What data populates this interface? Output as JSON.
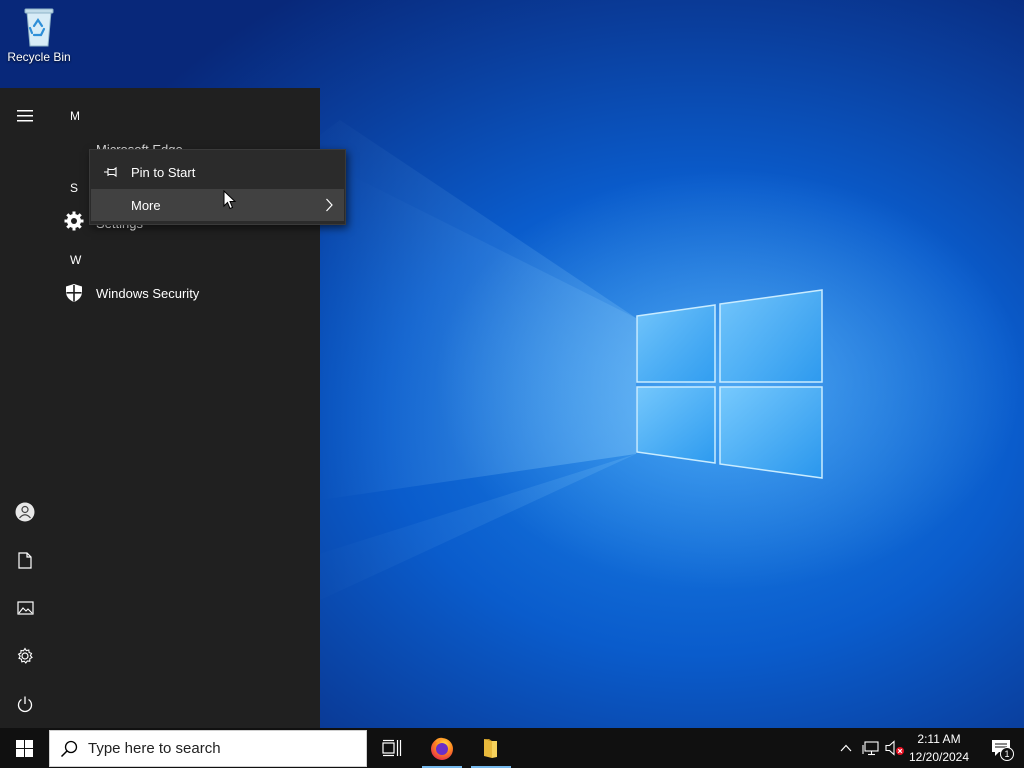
{
  "desktop": {
    "icons": [
      {
        "label": "Recycle Bin",
        "icon": "recycle-bin-icon"
      }
    ]
  },
  "start_menu": {
    "rail": [
      {
        "name": "expand",
        "icon": "hamburger-icon"
      },
      {
        "name": "account",
        "icon": "user-account-icon"
      },
      {
        "name": "documents",
        "icon": "document-icon"
      },
      {
        "name": "pictures",
        "icon": "pictures-icon"
      },
      {
        "name": "settings",
        "icon": "gear-icon"
      },
      {
        "name": "power",
        "icon": "power-icon"
      }
    ],
    "groups": [
      {
        "letter": "M",
        "apps": [
          {
            "label": "Microsoft Edge",
            "icon": "edge-icon"
          }
        ]
      },
      {
        "letter": "S",
        "apps": [
          {
            "label": "Settings",
            "icon": "gear-icon"
          }
        ]
      },
      {
        "letter": "W",
        "apps": [
          {
            "label": "Windows Security",
            "icon": "shield-icon"
          }
        ]
      }
    ]
  },
  "context_menu": {
    "items": [
      {
        "label": "Pin to Start",
        "icon": "pin-icon"
      },
      {
        "label": "More",
        "icon": "chevron-right-icon"
      }
    ]
  },
  "taskbar": {
    "search_placeholder": "Type here to search",
    "pinned": [
      {
        "name": "Task View",
        "icon": "task-view-icon"
      },
      {
        "name": "Firefox",
        "icon": "firefox-icon"
      },
      {
        "name": "File Explorer",
        "icon": "folder-icon"
      }
    ],
    "tray": {
      "time": "2:11 AM",
      "date": "12/20/2024",
      "notification_count": "1"
    }
  },
  "colors": {
    "accent_running": "#76b9ed",
    "start_bg": "#202020",
    "taskbar_bg": "#101010"
  }
}
